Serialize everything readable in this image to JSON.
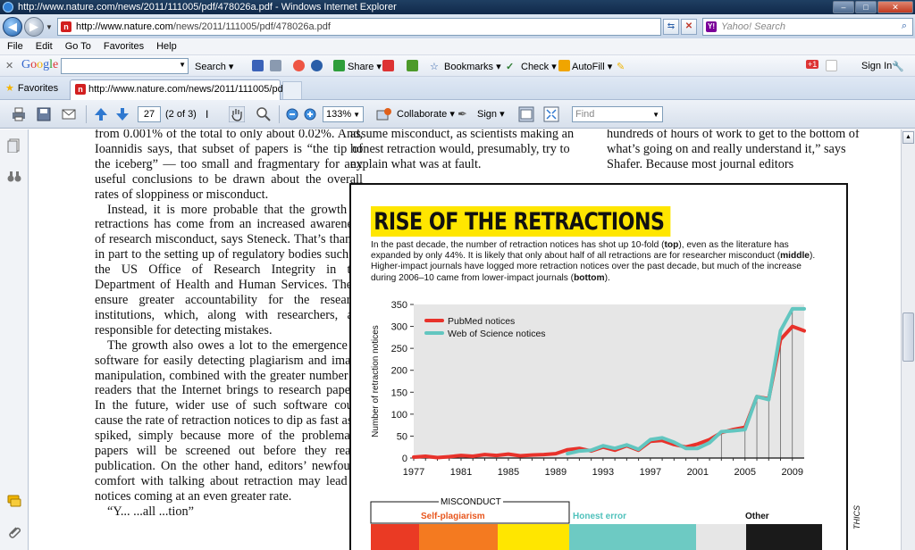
{
  "window": {
    "title": "http://www.nature.com/news/2011/111005/pdf/478026a.pdf - Windows Internet Explorer",
    "minimize": "–",
    "restore": "□",
    "close": "✕"
  },
  "address": {
    "url_host": "http://www.nature.com",
    "url_path": "/news/2011/111005/pdf/478026a.pdf",
    "search_placeholder": "Yahoo! Search",
    "site_icon": "nature-icon",
    "site_icon_letter": "n",
    "search_icon_letter": "Y!"
  },
  "menu": [
    "File",
    "Edit",
    "Go To",
    "Favorites",
    "Help"
  ],
  "google_toolbar": {
    "logo": "Google",
    "search": "Search ▾",
    "share": "Share ▾",
    "bookmarks": "Bookmarks ▾",
    "check": "Check ▾",
    "autofill": "AutoFill ▾",
    "badge": "+1",
    "sign_in": "Sign In"
  },
  "tabs": {
    "favorites": "Favorites",
    "active_tab": "http://www.nature.com/news/2011/111005/pdf/..."
  },
  "pdf_toolbar": {
    "page_number": "27",
    "page_count": "(2 of 3)",
    "zoom": "133%",
    "collaborate": "Collaborate ▾",
    "sign": "Sign ▾",
    "find_placeholder": "Find"
  },
  "article": {
    "col1": [
      {
        "indent": false,
        "text": "from 0.001% of the total to only about 0.02%. And, Ioannidis says, that subset of papers is “the tip of the iceberg” — too small and fragmentary for any useful conclusions to be drawn about the overall rates of sloppiness or misconduct."
      },
      {
        "indent": true,
        "text": "Instead, it is more probable that the growth in retractions has come from an increased awareness of research misconduct, says Steneck. That’s thanks in part to the setting up of regulatory bodies such as the US Office of Research Integrity in the Department of Health and Human Services. These ensure greater accountability for the research institutions, which, along with researchers, are responsible for detecting mistakes."
      },
      {
        "indent": true,
        "text": "The growth also owes a lot to the emergence of software for easily detecting plagiarism and image manipulation, combined with the greater number of readers that the Internet brings to research papers. In the future, wider use of such software could cause the rate of retraction notices to dip as fast as it spiked, simply because more of the problematic papers will be screened out before they reach publication. On the other hand, editors’ newfound comfort with talking about retraction may lead to notices coming at an even greater rate."
      },
      {
        "indent": true,
        "text": "“Y... ...all ...tion”"
      }
    ],
    "col2": "assume misconduct, as scientists making an honest retraction would, presumably, try to explain what was at fault.",
    "col3": "hundreds of hours of work to get to the bottom of what’s going on and really understand it,” says Shafer. Because most journal editors"
  },
  "figure": {
    "title": "RISE OF THE RETRACTIONS",
    "caption": [
      {
        "t": "In the past decade, the number of retraction notices has shot up 10-fold ("
      },
      {
        "b": "top"
      },
      {
        "t": "), even as the literature has expanded by only 44%. It is likely that only about half of all retractions are for researcher misconduct ("
      },
      {
        "b": "middle"
      },
      {
        "t": "). Higher-impact journals have logged more retraction notices over the past decade, but much of the increase during 2006–10 came from lower-impact journals ("
      },
      {
        "b": "bottom"
      },
      {
        "t": ")."
      }
    ],
    "misconduct_label": "MISCONDUCT",
    "self_plagiarism_label": "Self-plagiarism",
    "honest_error_label": "Honest error",
    "other_label": "Other",
    "side_credit": "THICS",
    "stack_colors": [
      "#ea3a24",
      "#f47a20",
      "#ffe600",
      "#6dcac3",
      "#e6e6e6",
      "#1a1a1a"
    ]
  },
  "chart_data": {
    "type": "line",
    "title": "",
    "xlabel": "",
    "ylabel": "Number of retraction notices",
    "xlim": [
      1977,
      2010
    ],
    "ylim": [
      0,
      350
    ],
    "x_ticks": [
      1977,
      1981,
      1985,
      1989,
      1993,
      1997,
      2001,
      2005,
      2009
    ],
    "y_ticks": [
      0,
      50,
      100,
      150,
      200,
      250,
      300,
      350
    ],
    "legend": "top-left",
    "grid": false,
    "series": [
      {
        "name": "PubMed notices",
        "color": "#e8322b",
        "x": [
          1977,
          1978,
          1979,
          1980,
          1981,
          1982,
          1983,
          1984,
          1985,
          1986,
          1987,
          1988,
          1989,
          1990,
          1991,
          1992,
          1993,
          1994,
          1995,
          1996,
          1997,
          1998,
          1999,
          2000,
          2001,
          2002,
          2003,
          2004,
          2005,
          2006,
          2007,
          2008,
          2009,
          2010
        ],
        "y": [
          2,
          4,
          1,
          3,
          6,
          4,
          8,
          6,
          9,
          5,
          7,
          8,
          10,
          19,
          22,
          16,
          25,
          18,
          28,
          18,
          38,
          40,
          31,
          25,
          32,
          42,
          58,
          65,
          70,
          140,
          135,
          270,
          300,
          290
        ]
      },
      {
        "name": "Web of Science notices",
        "color": "#62c6c0",
        "x": [
          1990,
          1991,
          1992,
          1993,
          1994,
          1995,
          1996,
          1997,
          1998,
          1999,
          2000,
          2001,
          2002,
          2003,
          2004,
          2005,
          2006,
          2007,
          2008,
          2009,
          2010
        ],
        "y": [
          10,
          16,
          18,
          28,
          22,
          30,
          20,
          42,
          46,
          36,
          22,
          22,
          35,
          60,
          62,
          65,
          140,
          133,
          290,
          340,
          340
        ]
      }
    ]
  }
}
